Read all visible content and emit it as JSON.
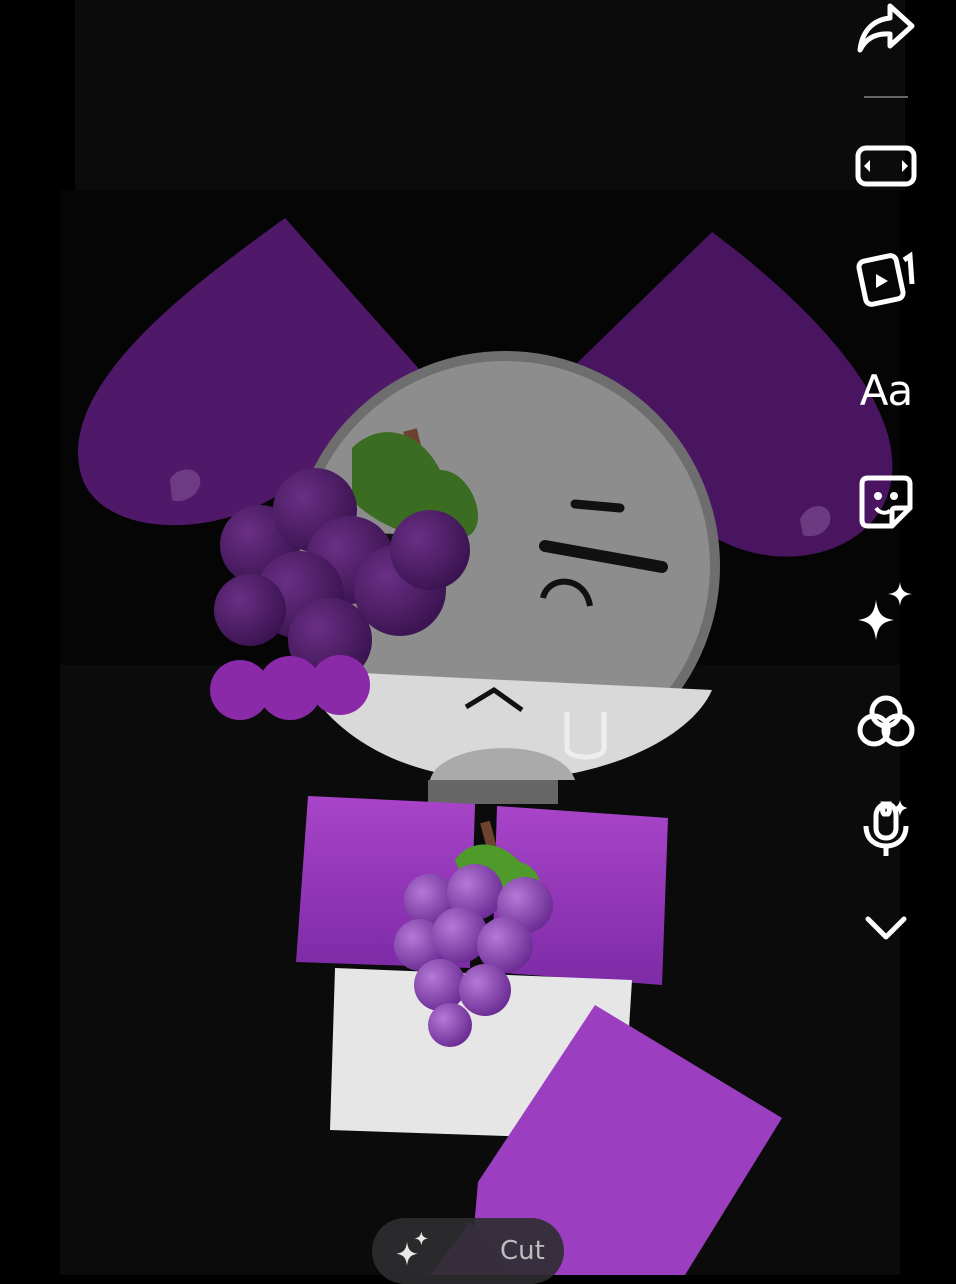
{
  "toolbar": {
    "items": [
      {
        "name": "share",
        "icon": "share-arrow-icon"
      },
      {
        "name": "aspect",
        "icon": "aspect-ratio-icon"
      },
      {
        "name": "clips",
        "icon": "video-clips-icon"
      },
      {
        "name": "text",
        "icon": "text-icon",
        "label": "Aa"
      },
      {
        "name": "stickers",
        "icon": "sticker-icon"
      },
      {
        "name": "effects",
        "icon": "sparkle-icon"
      },
      {
        "name": "filters",
        "icon": "filters-icon"
      },
      {
        "name": "voice",
        "icon": "voice-effect-icon"
      },
      {
        "name": "more",
        "icon": "chevron-down-icon"
      }
    ]
  },
  "cutout": {
    "label": "Cut",
    "icon": "sparkle-icon"
  },
  "colors": {
    "accent_purple": "#9b3fc0",
    "dark_purple": "#4a1760",
    "ear_purple": "#5e1c7c",
    "head_gray": "#9a9a9a"
  }
}
